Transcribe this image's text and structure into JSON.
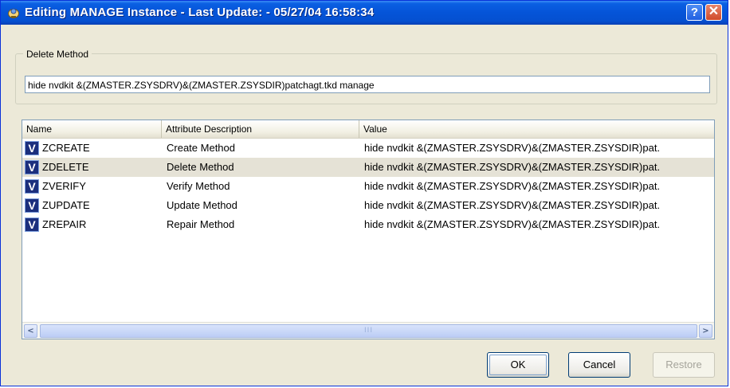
{
  "window": {
    "title": "Editing MANAGE Instance - Last Update: - 05/27/04 16:58:34",
    "help_label": "?",
    "close_label": "✕"
  },
  "delete_method": {
    "legend": "Delete Method",
    "value": "hide nvdkit &(ZMASTER.ZSYSDRV)&(ZMASTER.ZSYSDIR)patchagt.tkd manage"
  },
  "list": {
    "columns": [
      "Name",
      "Attribute Description",
      "Value"
    ],
    "icon_glyph": "V",
    "rows": [
      {
        "name": "ZCREATE",
        "description": "Create Method",
        "value": "hide nvdkit &(ZMASTER.ZSYSDRV)&(ZMASTER.ZSYSDIR)pat."
      },
      {
        "name": "ZDELETE",
        "description": "Delete Method",
        "value": "hide nvdkit &(ZMASTER.ZSYSDRV)&(ZMASTER.ZSYSDIR)pat."
      },
      {
        "name": "ZVERIFY",
        "description": "Verify Method",
        "value": "hide nvdkit &(ZMASTER.ZSYSDRV)&(ZMASTER.ZSYSDIR)pat."
      },
      {
        "name": "ZUPDATE",
        "description": "Update Method",
        "value": "hide nvdkit &(ZMASTER.ZSYSDRV)&(ZMASTER.ZSYSDIR)pat."
      },
      {
        "name": "ZREPAIR",
        "description": "Repair Method",
        "value": "hide nvdkit &(ZMASTER.ZSYSDRV)&(ZMASTER.ZSYSDIR)pat."
      }
    ],
    "selected_row": "ZDELETE"
  },
  "scrollbar": {
    "left_arrow": "<",
    "right_arrow": ">",
    "grip": "III"
  },
  "buttons": {
    "ok": "OK",
    "cancel": "Cancel",
    "restore": "Restore"
  },
  "colors": {
    "titlebar": "#0554d8",
    "dialog_bg": "#ece9d8",
    "icon_bg": "#1b2f7d",
    "selected_row": "#e5e2d6"
  },
  "icons": {
    "app": "app-icon",
    "row": "v-method-icon",
    "help": "help-icon",
    "close": "close-icon"
  }
}
